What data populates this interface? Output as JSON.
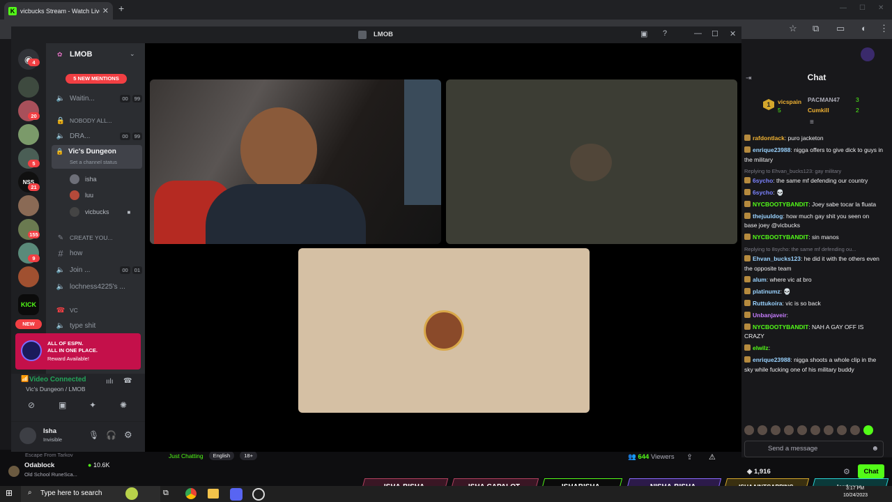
{
  "browser": {
    "tab_title": "vicbucks Stream - Watch Live o",
    "new_tab": "+"
  },
  "discord": {
    "window_title": "LMOB",
    "server_name": "LMOB",
    "home_badge": "4",
    "new_mentions": "5 NEW MENTIONS",
    "guild_badges": [
      "20",
      "5",
      "21",
      "155",
      "9"
    ],
    "new_label": "NEW",
    "kick_label": "KICK",
    "channels": [
      {
        "name": "Waitin...",
        "type": "voice",
        "c1": "00",
        "c2": "99"
      },
      {
        "name": "NOBODY ALL...",
        "type": "category"
      },
      {
        "name": "DRA...",
        "type": "voice",
        "c1": "00",
        "c2": "99"
      }
    ],
    "active_channel": {
      "name": "Vic's Dungeon",
      "status": "Set a channel status"
    },
    "voice_users": [
      "isha",
      "luu",
      "vicbucks"
    ],
    "channels2": [
      {
        "name": "CREATE YOU...",
        "type": "category"
      },
      {
        "name": "how",
        "type": "text"
      },
      {
        "name": "Join ...",
        "type": "voice",
        "c1": "00",
        "c2": "01"
      },
      {
        "name": "lochness4225's ...",
        "type": "voice"
      },
      {
        "name": "VC",
        "type": "category"
      },
      {
        "name": "type shit",
        "type": "voice"
      }
    ],
    "promo": {
      "line1": "ALL OF ESPN.",
      "line2": "ALL IN ONE PLACE.",
      "line3": "Reward Available!"
    },
    "voice_status": {
      "title": "Video Connected",
      "location": "Vic's Dungeon / LMOB"
    },
    "user": {
      "name": "Isha",
      "status": "Invisible"
    }
  },
  "kick": {
    "chat_title": "Chat",
    "leaderboard": [
      {
        "rank": "1",
        "name": "vicspain",
        "count": "5"
      },
      {
        "name": "PACMAN47",
        "count": "3"
      },
      {
        "name": "Cumkill",
        "count": "2"
      }
    ],
    "messages": [
      {
        "user": "rafdontlack",
        "color": "#f0b232",
        "text": ": puro jacketon"
      },
      {
        "user": "enrique23988",
        "color": "#9ad3ff",
        "text": ": nigga offers to give dick to guys in the military"
      },
      {
        "reply": "Replying to Ehvan_bucks123: gay military",
        "user": "6sycho",
        "color": "#7c83ff",
        "text": ": the same mf defending our country"
      },
      {
        "user": "6sycho",
        "color": "#7c83ff",
        "text": ": 💀"
      },
      {
        "user": "NYCBOOTYBANDIT",
        "color": "#53fc18",
        "text": ": Joey sabe tocar la fluata"
      },
      {
        "user": "thejuuldog",
        "color": "#9ad3ff",
        "text": ": how much gay shit you seen on base joey @vicbucks"
      },
      {
        "user": "NYCBOOTYBANDIT",
        "color": "#53fc18",
        "text": ": sin manos"
      },
      {
        "reply": "Replying to 8sycho: the same mf defending ou...",
        "user": "Ehvan_bucks123",
        "color": "#9ad3ff",
        "text": ": he did it with the others even the opposite team"
      },
      {
        "user": "alum",
        "color": "#9ad3ff",
        "text": ": where vic at bro"
      },
      {
        "user": "platinumz",
        "color": "#9ad3ff",
        "text": ": 💀"
      },
      {
        "user": "Ruttukoira",
        "color": "#9ad3ff",
        "text": ": vic is so back"
      },
      {
        "user": "Unbanjaveir",
        "color": "#c77dff",
        "text": ":"
      },
      {
        "user": "NYCBOOTYBANDIT",
        "color": "#53fc18",
        "text": ": NAH A GAY OFF IS CRAZY"
      },
      {
        "user": "elwilz",
        "color": "#53fc18",
        "text": ":"
      },
      {
        "user": "enrique23988",
        "color": "#9ad3ff",
        "text": ": nigga shoots a whole clip in the sky while fucking one of his military buddy"
      }
    ],
    "send_placeholder": "Send a message",
    "points": "1,916",
    "chat_button": "Chat",
    "viewers": "644",
    "viewers_label": "Viewers",
    "category": "Just Chatting",
    "language": "English",
    "age": "18+",
    "streamer_name": "Odablock",
    "streamer_game": "Old School RuneSca...",
    "streamer_viewers": "10.6K",
    "above_streamer": "Escape From Tarkov"
  },
  "socials": [
    "ISHA-BISHA",
    "ISHA.CAPALOT",
    "ISHABISHA",
    "NISHA-BISHA",
    "ISHAAINTCAPPING",
    "lordanna"
  ],
  "taskbar": {
    "search_placeholder": "Type here to search",
    "time": "3:17 PM",
    "date": "10/24/2023"
  },
  "colors": {
    "kick_green": "#53fc18",
    "discord_red": "#f23f43",
    "discord_bg": "#2b2d31"
  }
}
